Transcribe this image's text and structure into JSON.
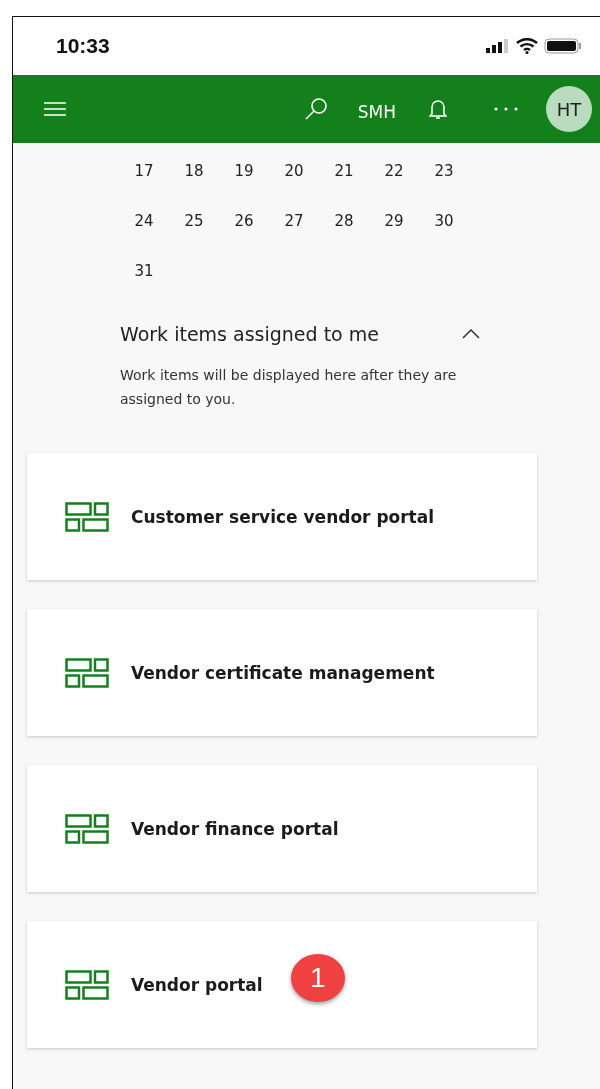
{
  "status_bar": {
    "time": "10:33"
  },
  "header": {
    "company": "SMH",
    "avatar": "HT"
  },
  "calendar": {
    "weeks": [
      [
        "17",
        "18",
        "19",
        "20",
        "21",
        "22",
        "23"
      ],
      [
        "24",
        "25",
        "26",
        "27",
        "28",
        "29",
        "30"
      ],
      [
        "31"
      ]
    ]
  },
  "work_items": {
    "title": "Work items assigned to me",
    "expanded": true,
    "message": "Work items will be displayed here after they are assigned to you."
  },
  "workspaces": [
    {
      "label": "Customer service vendor portal"
    },
    {
      "label": "Vendor certificate management"
    },
    {
      "label": "Vendor finance portal"
    },
    {
      "label": "Vendor portal",
      "badge": "1"
    }
  ]
}
